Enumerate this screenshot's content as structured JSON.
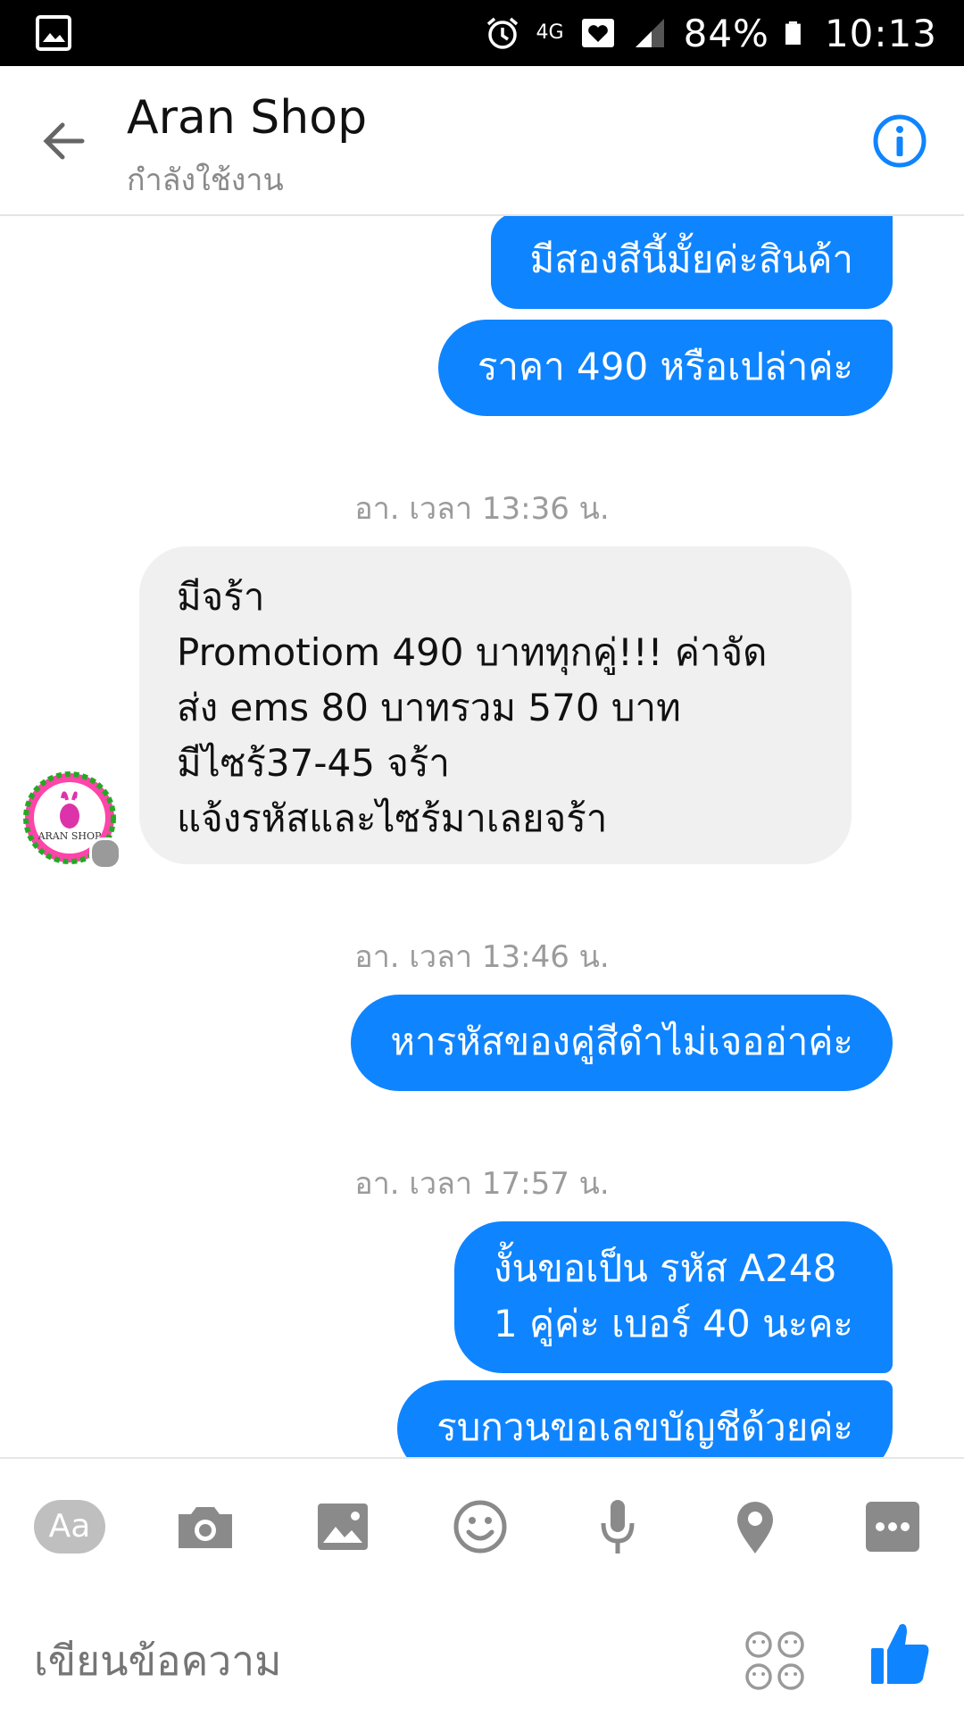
{
  "status_bar": {
    "battery": "84%",
    "time": "10:13",
    "network": "4G"
  },
  "header": {
    "title": "Aran Shop",
    "subtitle": "กำลังใช้งาน"
  },
  "messages": [
    {
      "type": "out",
      "text": "มีสองสีนี้มั้ยค่ะสินค้า"
    },
    {
      "type": "out",
      "text": "ราคา 490 หรือเปล่าค่ะ"
    },
    {
      "type": "timestamp",
      "text": "อา. เวลา 13:36 น."
    },
    {
      "type": "in",
      "text": "มีจร้า\nPromotiom 490 บาททุกคู่!!! ค่าจัด\nส่ง ems 80 บาทรวม 570 บาท\nมีไซร้37-45 จร้า\nแจ้งรหัสและไซร้มาเลยจร้า"
    },
    {
      "type": "timestamp",
      "text": "อา. เวลา 13:46 น."
    },
    {
      "type": "out",
      "text": "หารหัสของคู่สีดำไม่เจออ่าค่ะ"
    },
    {
      "type": "timestamp",
      "text": "อา. เวลา 17:57 น."
    },
    {
      "type": "out",
      "text": "งั้นขอเป็น รหัส A248\n1  คู่ค่ะ เบอร์ 40 นะคะ"
    },
    {
      "type": "out",
      "text": "รบกวนขอเลขบัญชีด้วยค่ะ"
    }
  ],
  "avatar": {
    "label": "ARAN SHOP"
  },
  "composer": {
    "aa_label": "Aa",
    "placeholder": "เขียนข้อความ"
  },
  "colors": {
    "accent": "#0f84ff",
    "incoming_bubble": "#f1f0f0",
    "icon_gray": "#8a8a8a"
  }
}
